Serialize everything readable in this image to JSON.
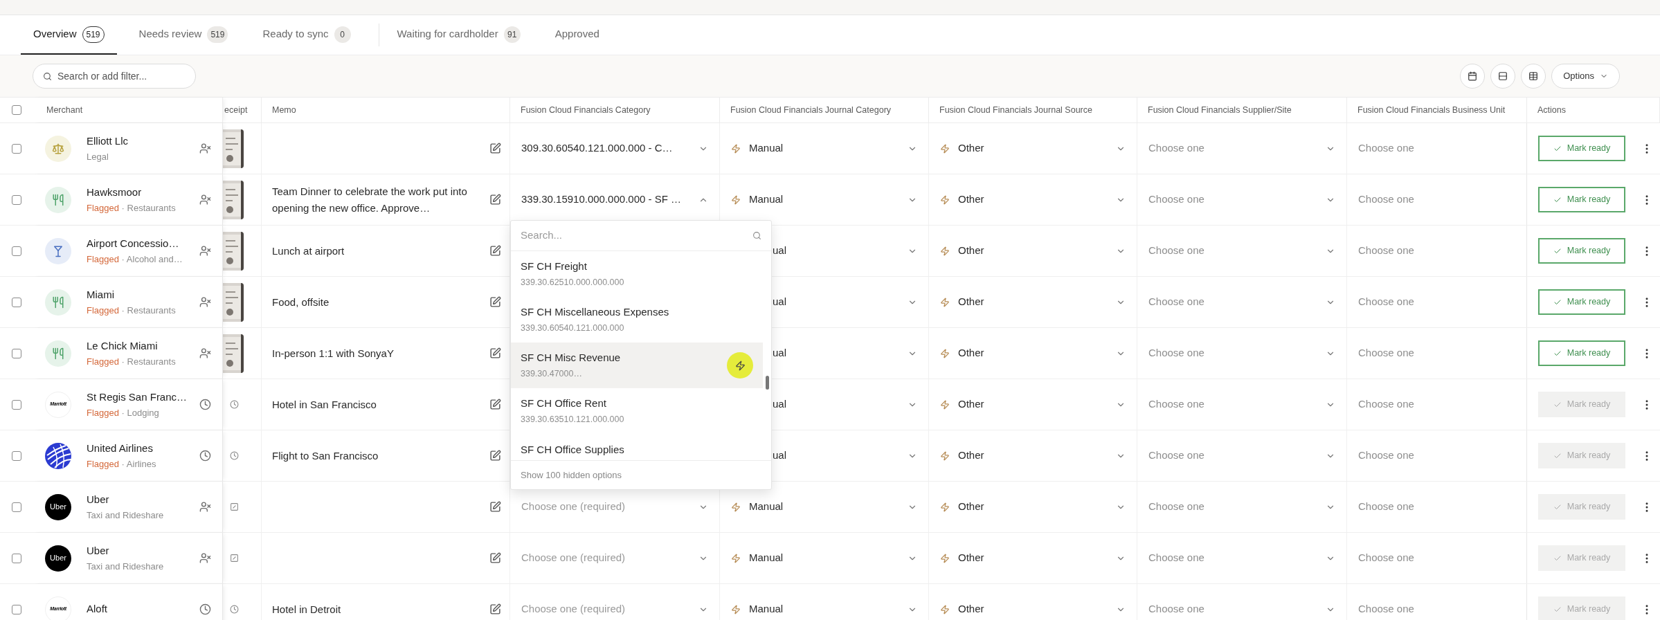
{
  "tabs": [
    {
      "label": "Overview",
      "count": "519",
      "selected": true,
      "divider_before": false
    },
    {
      "label": "Needs review",
      "count": "519",
      "selected": false,
      "divider_before": false
    },
    {
      "label": "Ready to sync",
      "count": "0",
      "selected": false,
      "divider_before": false
    },
    {
      "label": "Waiting for cardholder",
      "count": "91",
      "selected": false,
      "divider_before": true
    },
    {
      "label": "Approved",
      "selected": false,
      "divider_before": false
    }
  ],
  "search": {
    "placeholder": "Search or add filter..."
  },
  "options_button": {
    "label": "Options"
  },
  "table": {
    "header_checkbox": {
      "checked": false
    },
    "columns": [
      "Merchant",
      "eceipt",
      "Memo",
      "Fusion Cloud Financials Category",
      "Fusion Cloud Financials Journal Category",
      "Fusion Cloud Financials Journal Source",
      "Fusion Cloud Financials Supplier/Site",
      "Fusion Cloud Financials Business Unit",
      "Actions"
    ],
    "rows": [
      {
        "checked": false,
        "merchant": {
          "name": "Elliott Llc",
          "logo": {
            "kind": "legal"
          },
          "category": "Legal",
          "status_icon": {
            "kind": "unassigned"
          }
        },
        "category": {
          "value": "309.30.60540.121.000.000 - C…",
          "expanded": false
        },
        "journal_category": {
          "value": "Manual",
          "covered": false
        },
        "journal_source": "Other",
        "supplier": "Choose one",
        "business_unit": "Choose one",
        "mark_ready": {
          "label": "Mark ready",
          "disabled": false
        }
      },
      {
        "checked": false,
        "merchant": {
          "name": "Hawksmoor",
          "logo": {
            "kind": "restaurant"
          },
          "flag": "Flagged",
          "separator": "·",
          "category": "Restaurants",
          "status_icon": {
            "kind": "unassigned"
          }
        },
        "memo": "Team Dinner to celebrate the work put into opening the new office. Approve…",
        "category": {
          "value": "339.30.15910.000.000.000 - SF …",
          "expanded": true
        },
        "journal_category": {
          "value": "Manual",
          "covered": false
        },
        "journal_source": "Other",
        "supplier": "Choose one",
        "business_unit": "Choose one",
        "mark_ready": {
          "label": "Mark ready",
          "disabled": false
        }
      },
      {
        "checked": false,
        "merchant": {
          "name": "Airport Concessio…",
          "logo": {
            "kind": "bar"
          },
          "flag": "Flagged",
          "separator": "·",
          "category": "Alcohol and…",
          "status_icon": {
            "kind": "unassigned"
          }
        },
        "memo": "Lunch at airport",
        "journal_category": {
          "value": "ual",
          "covered": true
        },
        "journal_source": "Other",
        "supplier": "Choose one",
        "business_unit": "Choose one",
        "mark_ready": {
          "label": "Mark ready",
          "disabled": false
        }
      },
      {
        "checked": false,
        "merchant": {
          "name": "Miami",
          "logo": {
            "kind": "restaurant"
          },
          "flag": "Flagged",
          "separator": "·",
          "category": "Restaurants",
          "status_icon": {
            "kind": "unassigned"
          }
        },
        "memo": "Food, offsite",
        "journal_category": {
          "value": "ual",
          "covered": true
        },
        "journal_source": "Other",
        "supplier": "Choose one",
        "business_unit": "Choose one",
        "mark_ready": {
          "label": "Mark ready",
          "disabled": false
        }
      },
      {
        "checked": false,
        "merchant": {
          "name": "Le Chick Miami",
          "logo": {
            "kind": "restaurant"
          },
          "flag": "Flagged",
          "separator": "·",
          "category": "Restaurants",
          "status_icon": {
            "kind": "unassigned"
          }
        },
        "memo": "In-person 1:1 with SonyaY",
        "journal_category": {
          "value": "ual",
          "covered": true
        },
        "journal_source": "Other",
        "supplier": "Choose one",
        "business_unit": "Choose one",
        "mark_ready": {
          "label": "Mark ready",
          "disabled": false
        }
      },
      {
        "checked": false,
        "merchant": {
          "name": "St Regis San Franc…",
          "logo": {
            "kind": "wordmark",
            "text": "Marriott"
          },
          "flag": "Flagged",
          "separator": "·",
          "category": "Lodging",
          "status_icon": {
            "kind": "pending"
          }
        },
        "receipt": {
          "kind": "pending"
        },
        "memo": "Hotel in San Francisco",
        "journal_category": {
          "value": "ual",
          "covered": true
        },
        "journal_source": "Other",
        "supplier": "Choose one",
        "business_unit": "Choose one",
        "mark_ready": {
          "label": "Mark ready",
          "disabled": true
        }
      },
      {
        "checked": false,
        "merchant": {
          "name": "United Airlines",
          "logo": {
            "kind": "globe"
          },
          "flag": "Flagged",
          "separator": "·",
          "category": "Airlines",
          "status_icon": {
            "kind": "pending"
          }
        },
        "receipt": {
          "kind": "pending"
        },
        "memo": "Flight to San Francisco",
        "journal_category": {
          "value": "ual",
          "covered": true
        },
        "journal_source": "Other",
        "supplier": "Choose one",
        "business_unit": "Choose one",
        "mark_ready": {
          "label": "Mark ready",
          "disabled": true
        }
      },
      {
        "checked": false,
        "merchant": {
          "name": "Uber",
          "logo": {
            "kind": "badge",
            "text": "Uber"
          },
          "category": "Taxi and Rideshare",
          "status_icon": {
            "kind": "unassigned"
          }
        },
        "receipt": {
          "kind": "missing"
        },
        "category": {
          "placeholder": "Choose one (required)",
          "expanded": false
        },
        "journal_category": {
          "value": "Manual",
          "covered": false
        },
        "journal_source": "Other",
        "supplier": "Choose one",
        "business_unit": "Choose one",
        "mark_ready": {
          "label": "Mark ready",
          "disabled": true
        }
      },
      {
        "checked": false,
        "merchant": {
          "name": "Uber",
          "logo": {
            "kind": "badge",
            "text": "Uber"
          },
          "category": "Taxi and Rideshare",
          "status_icon": {
            "kind": "unassigned"
          }
        },
        "receipt": {
          "kind": "missing"
        },
        "category": {
          "placeholder": "Choose one (required)",
          "expanded": false
        },
        "journal_category": {
          "value": "Manual",
          "covered": false
        },
        "journal_source": "Other",
        "supplier": "Choose one",
        "business_unit": "Choose one",
        "mark_ready": {
          "label": "Mark ready",
          "disabled": true
        }
      },
      {
        "checked": false,
        "merchant": {
          "name": "Aloft",
          "logo": {
            "kind": "wordmark",
            "text": "Marriott"
          },
          "status_icon": {
            "kind": "pending"
          }
        },
        "receipt": {
          "kind": "pending"
        },
        "memo": "Hotel in Detroit",
        "category": {
          "placeholder": "Choose one (required)",
          "expanded": false
        },
        "journal_category": {
          "value": "Manual",
          "covered": false
        },
        "journal_source": "Other",
        "supplier": "Choose one",
        "business_unit": "Choose one",
        "mark_ready": {
          "label": "Mark ready",
          "disabled": true
        }
      }
    ]
  },
  "dropdown": {
    "placeholder": "Search...",
    "options": [
      {
        "name": "SF CH Freight",
        "code": "339.30.62510.000.000.000",
        "selected": false
      },
      {
        "name": "SF CH Miscellaneous Expenses",
        "code": "339.30.60540.121.000.000",
        "selected": false
      },
      {
        "name": "SF CH Misc Revenue",
        "code": "339.30.47000…",
        "selected": true
      },
      {
        "name": "SF CH Office Rent",
        "code": "339.30.63510.121.000.000",
        "selected": false
      },
      {
        "name": "SF CH Office Supplies",
        "selected": false
      }
    ],
    "footer": "Show 100 hidden options"
  }
}
